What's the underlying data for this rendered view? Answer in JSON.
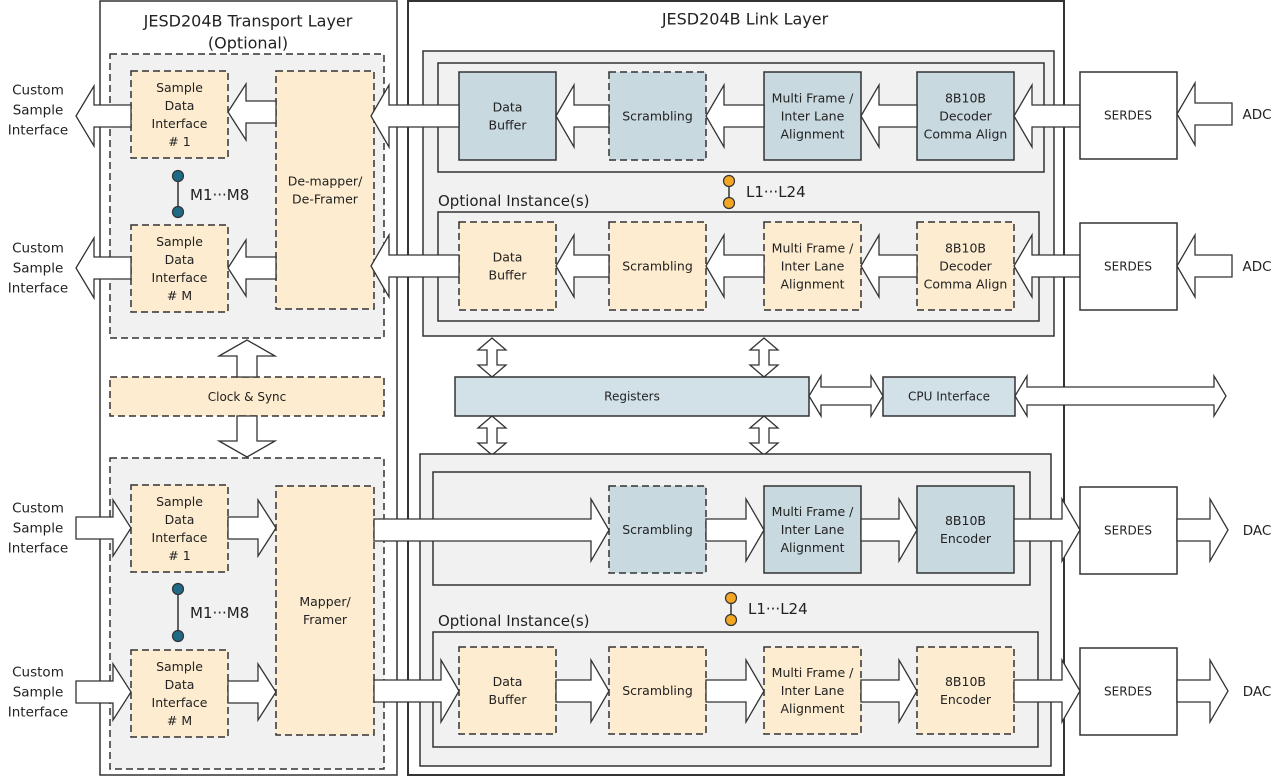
{
  "colors": {
    "active_block": "#c9d9e0",
    "optional_block": "#fdeccf",
    "panel_gray": "#f1f1f1",
    "register_block": "#d2e1e8",
    "teal_dot": "#1f6a86",
    "orange_dot": "#f4a623",
    "stroke": "#333333"
  },
  "transport": {
    "title_line1": "JESD204B Transport Layer",
    "title_line2": "(Optional)",
    "rx": {
      "sdi1": [
        "Sample",
        "Data",
        "Interface",
        "# 1"
      ],
      "sdiM": [
        "Sample",
        "Data",
        "Interface",
        "# M"
      ],
      "range": "M1···M8",
      "core": [
        "De-mapper/",
        "De-Framer"
      ]
    },
    "clock": "Clock & Sync",
    "tx": {
      "sdi1": [
        "Sample",
        "Data",
        "Interface",
        "# 1"
      ],
      "sdiM": [
        "Sample",
        "Data",
        "Interface",
        "# M"
      ],
      "range": "M1···M8",
      "core": [
        "Mapper/",
        "Framer"
      ]
    },
    "custom_interface": [
      "Custom",
      "Sample",
      "Interface"
    ]
  },
  "link": {
    "title": "JESD204B Link Layer",
    "optional_label": "Optional Instance(s)",
    "lane_range": "L1···L24",
    "rx_blocks": {
      "buffer": [
        "Data",
        "Buffer"
      ],
      "scrambling": [
        "Scrambling"
      ],
      "alignment": [
        "Multi Frame /",
        "Inter Lane",
        "Alignment"
      ],
      "decoder": [
        "8B10B",
        "Decoder",
        "Comma Align"
      ]
    },
    "tx_blocks": {
      "buffer": [
        "Data",
        "Buffer"
      ],
      "scrambling": [
        "Scrambling"
      ],
      "alignment": [
        "Multi Frame /",
        "Inter Lane",
        "Alignment"
      ],
      "encoder": [
        "8B10B",
        "Encoder"
      ]
    },
    "registers": "Registers",
    "cpu_interface": "CPU Interface"
  },
  "external": {
    "serdes": "SERDES",
    "adc": "ADC",
    "dac": "DAC"
  }
}
